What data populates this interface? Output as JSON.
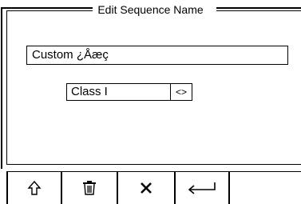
{
  "dialog": {
    "title": "Edit Sequence Name"
  },
  "sequence_name": {
    "value": "Custom ¿Åæç"
  },
  "class_select": {
    "value": "Class I",
    "arrows": "<>"
  },
  "footer": {
    "buttons": [
      {
        "icon": "shift-up-arrow-icon"
      },
      {
        "icon": "trash-icon"
      },
      {
        "icon": "close-x-icon"
      },
      {
        "icon": "enter-return-icon"
      }
    ]
  }
}
